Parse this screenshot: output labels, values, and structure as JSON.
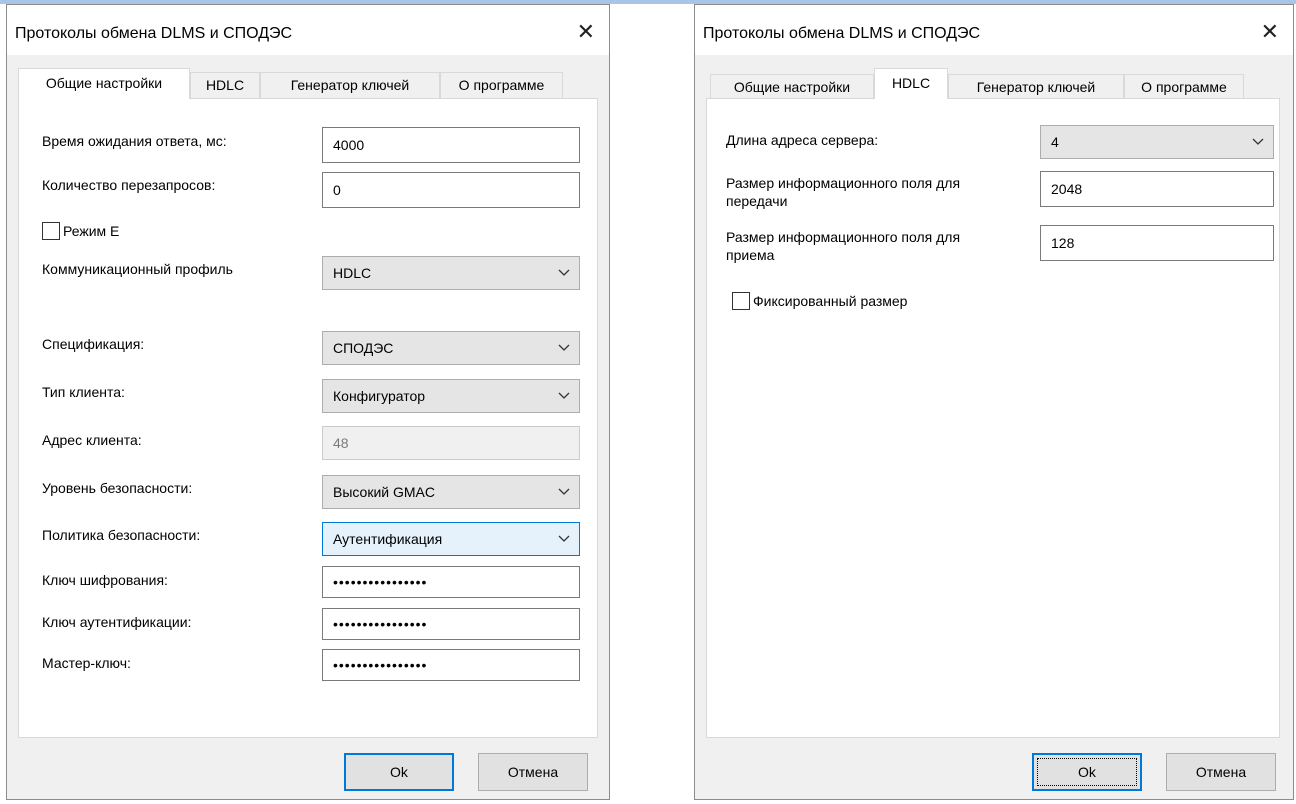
{
  "dialogs": [
    {
      "title": "Протоколы обмена DLMS и СПОДЭС",
      "tabs": [
        "Общие настройки",
        "HDLC",
        "Генератор ключей",
        "О программе"
      ],
      "active_tab": 0,
      "fields": {
        "response_timeout_label": "Время ожидания ответа, мс:",
        "response_timeout_value": "4000",
        "retries_label": "Количество перезапросов:",
        "retries_value": "0",
        "mode_e_label": "Режим Е",
        "comm_profile_label": "Коммуникационный профиль",
        "comm_profile_value": "HDLC",
        "spec_label": "Спецификация:",
        "spec_value": "СПОДЭС",
        "client_type_label": "Тип клиента:",
        "client_type_value": "Конфигуратор",
        "client_address_label": "Адрес клиента:",
        "client_address_value": "48",
        "security_level_label": "Уровень безопасности:",
        "security_level_value": "Высокий GMAC",
        "security_policy_label": "Политика безопасности:",
        "security_policy_value": "Аутентификация",
        "enc_key_label": "Ключ шифрования:",
        "enc_key_value": "••••••••••••••••",
        "auth_key_label": "Ключ аутентификации:",
        "auth_key_value": "••••••••••••••••",
        "master_key_label": "Мастер-ключ:",
        "master_key_value": "••••••••••••••••"
      },
      "ok_label": "Ok",
      "cancel_label": "Отмена"
    },
    {
      "title": "Протоколы обмена DLMS и СПОДЭС",
      "tabs": [
        "Общие настройки",
        "HDLC",
        "Генератор ключей",
        "О программе"
      ],
      "active_tab": 1,
      "fields": {
        "server_addr_len_label": "Длина адреса сервера:",
        "server_addr_len_value": "4",
        "tx_info_size_label": "Размер информационного поля для передачи",
        "tx_info_size_value": "2048",
        "rx_info_size_label": "Размер информационного поля для приема",
        "rx_info_size_value": "128",
        "fixed_size_label": "Фиксированный размер"
      },
      "ok_label": "Ok",
      "cancel_label": "Отмена"
    }
  ],
  "icons": {
    "close": "close-icon",
    "dropdown": "chevron-down-icon"
  },
  "colors": {
    "accent": "#0078d7",
    "panel": "#ffffff",
    "dialog_bg": "#f0f0f0"
  }
}
